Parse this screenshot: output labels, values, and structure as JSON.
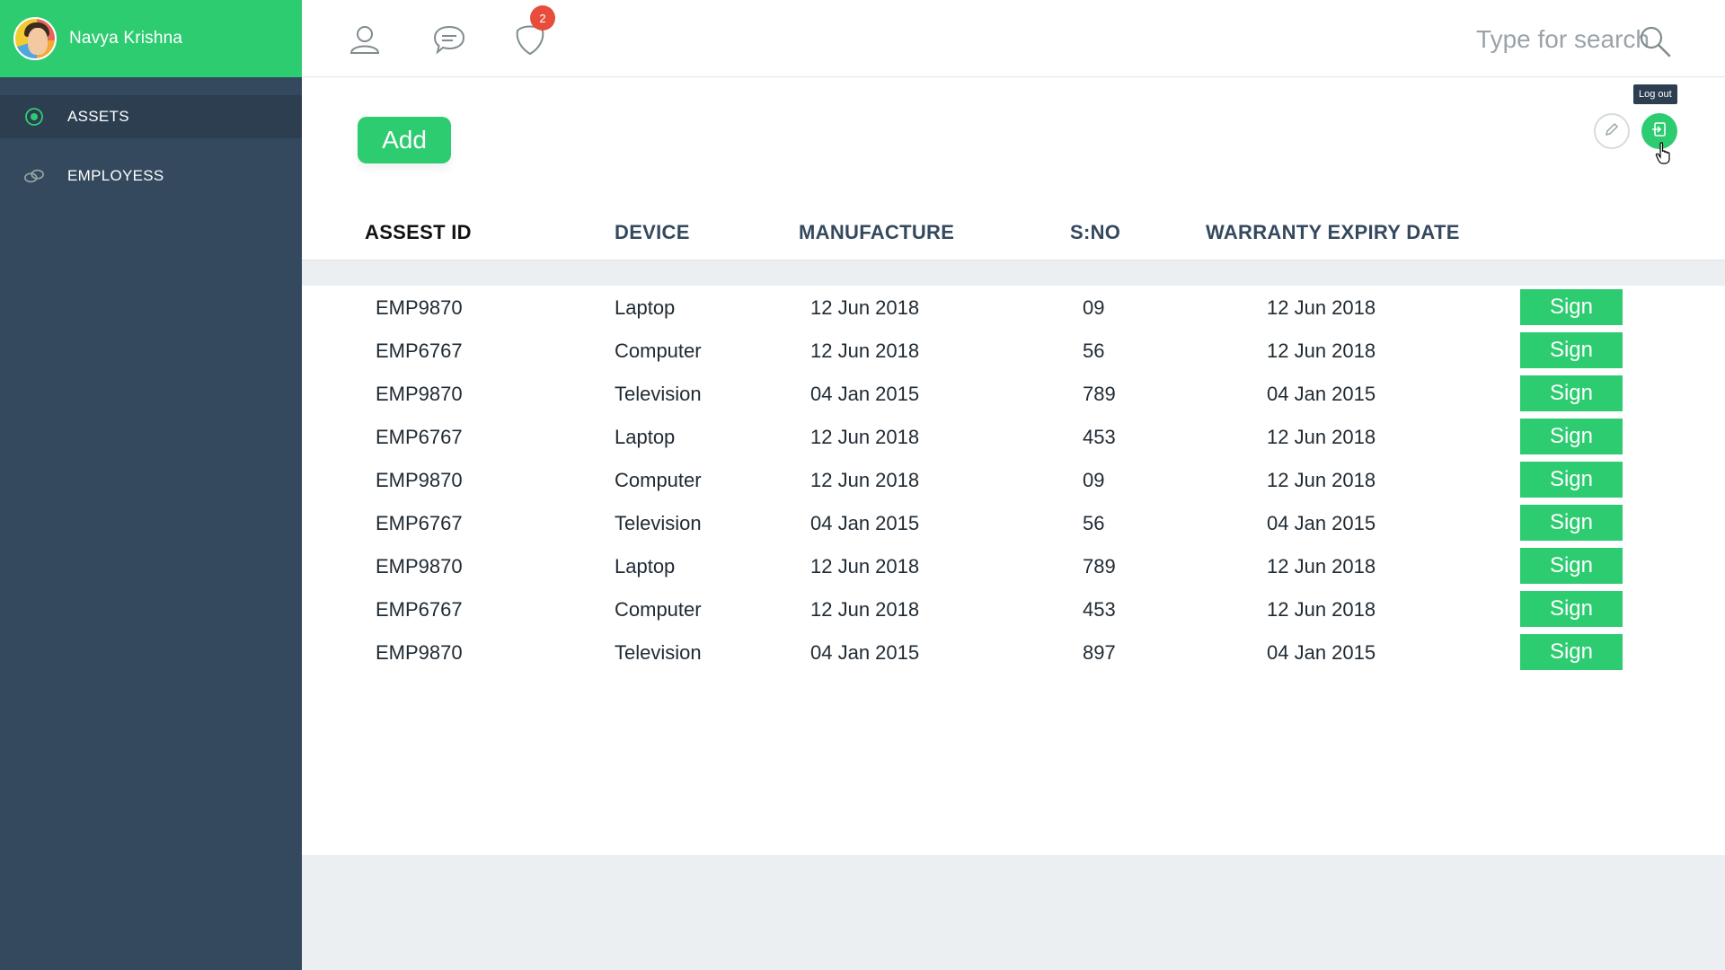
{
  "user": {
    "name": "Navya Krishna"
  },
  "nav": {
    "items": [
      {
        "label": "ASSETS",
        "icon": "target-icon",
        "active": true
      },
      {
        "label": "EMPLOYESS",
        "icon": "link-icon",
        "active": false
      }
    ]
  },
  "topbar": {
    "notification_count": "2",
    "search_placeholder": "Type for search"
  },
  "toolbar": {
    "add_label": "Add",
    "logout_tooltip": "Log out"
  },
  "table": {
    "headers": [
      "ASSEST ID",
      "DEVICE",
      "MANUFACTURE",
      "S:NO",
      "WARRANTY EXPIRY DATE"
    ],
    "rows": [
      {
        "asset_id": "EMP9870",
        "device": "Laptop",
        "manufacture": "12 Jun 2018",
        "sno": "09",
        "warranty": "12 Jun 2018",
        "action": "Sign"
      },
      {
        "asset_id": "EMP6767",
        "device": "Computer",
        "manufacture": "12 Jun 2018",
        "sno": "56",
        "warranty": "12 Jun 2018",
        "action": "Sign"
      },
      {
        "asset_id": "EMP9870",
        "device": "Television",
        "manufacture": "04 Jan 2015",
        "sno": "789",
        "warranty": "04 Jan 2015",
        "action": "Sign"
      },
      {
        "asset_id": "EMP6767",
        "device": "Laptop",
        "manufacture": "12 Jun 2018",
        "sno": "453",
        "warranty": "12 Jun 2018",
        "action": "Sign"
      },
      {
        "asset_id": "EMP9870",
        "device": "Computer",
        "manufacture": "12 Jun 2018",
        "sno": "09",
        "warranty": "12 Jun 2018",
        "action": "Sign"
      },
      {
        "asset_id": "EMP6767",
        "device": "Television",
        "manufacture": "04 Jan 2015",
        "sno": "56",
        "warranty": "04 Jan 2015",
        "action": "Sign"
      },
      {
        "asset_id": "EMP9870",
        "device": "Laptop",
        "manufacture": "12 Jun 2018",
        "sno": "789",
        "warranty": "12 Jun 2018",
        "action": "Sign"
      },
      {
        "asset_id": "EMP6767",
        "device": "Computer",
        "manufacture": "12 Jun 2018",
        "sno": "453",
        "warranty": "12 Jun 2018",
        "action": "Sign"
      },
      {
        "asset_id": "EMP9870",
        "device": "Television",
        "manufacture": "04 Jan 2015",
        "sno": "897",
        "warranty": "04 Jan 2015",
        "action": "Sign"
      }
    ]
  },
  "colors": {
    "accent": "#2ecc71",
    "sidebar": "#34495e",
    "sidebar_active": "#2c3e50",
    "badge": "#e74c3c"
  }
}
